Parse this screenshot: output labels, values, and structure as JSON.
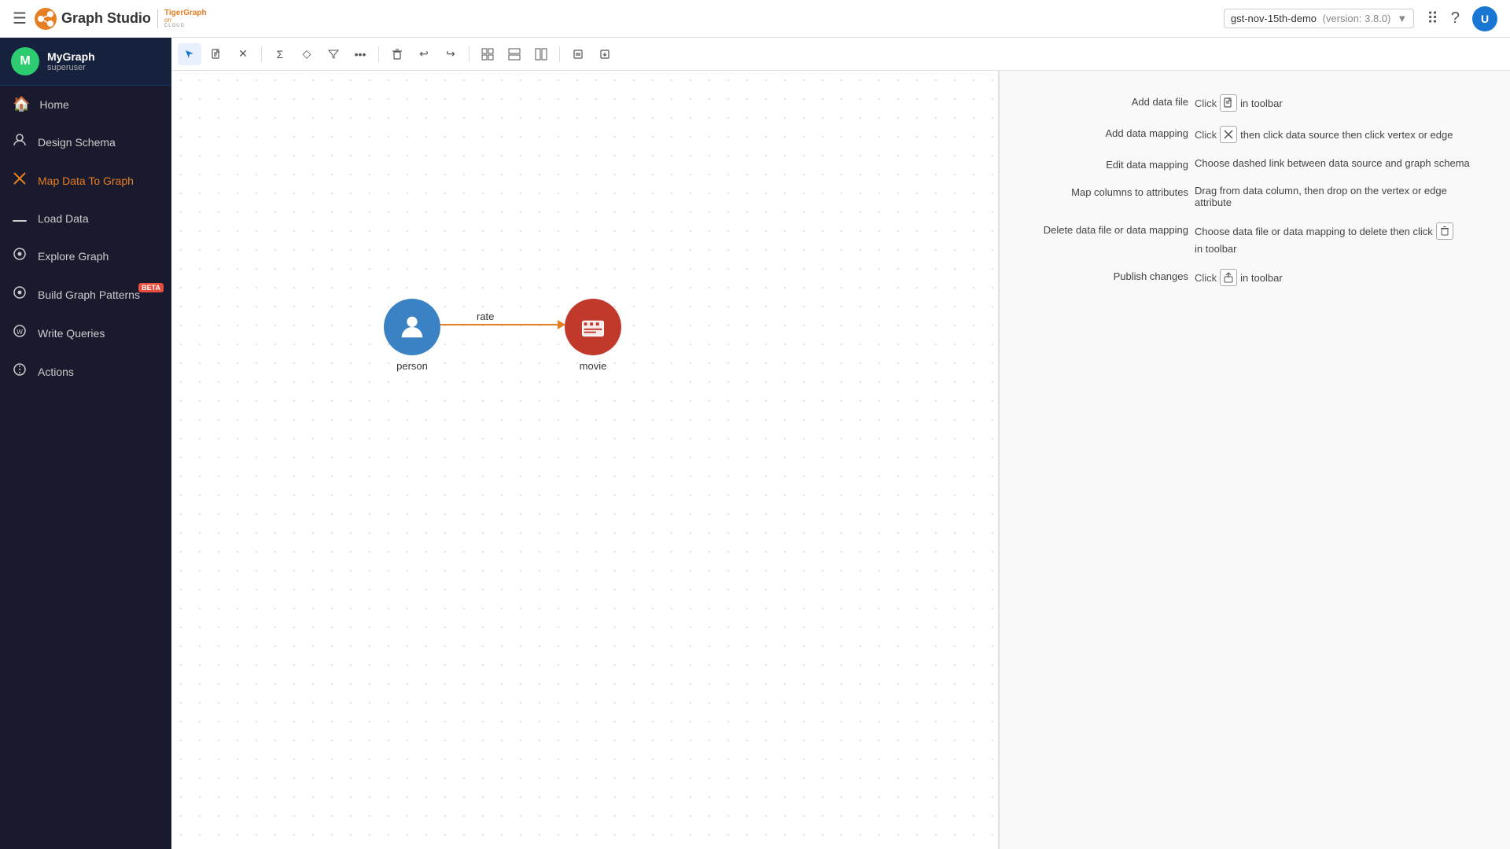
{
  "topbar": {
    "menu_icon": "☰",
    "app_title": "Graph Studio",
    "graph_selector": {
      "label": "gst-nov-15th-demo",
      "version": "(version: 3.8.0)"
    },
    "avatar_initials": "U"
  },
  "sidebar": {
    "graph": {
      "name": "MyGraph",
      "user": "superuser",
      "avatar": "M"
    },
    "nav_items": [
      {
        "id": "home",
        "label": "Home",
        "icon": "🏠",
        "active": false
      },
      {
        "id": "design-schema",
        "label": "Design Schema",
        "icon": "👤",
        "active": false
      },
      {
        "id": "map-data",
        "label": "Map Data To Graph",
        "icon": "✕",
        "active": true
      },
      {
        "id": "load-data",
        "label": "Load Data",
        "icon": "━",
        "active": false
      },
      {
        "id": "explore-graph",
        "label": "Explore Graph",
        "icon": "⊙",
        "active": false
      },
      {
        "id": "build-patterns",
        "label": "Build Graph Patterns",
        "icon": "⊙",
        "active": false,
        "beta": true
      },
      {
        "id": "write-queries",
        "label": "Write Queries",
        "icon": "🌐",
        "active": false
      },
      {
        "id": "actions",
        "label": "Actions",
        "icon": "⚙",
        "active": false
      }
    ]
  },
  "toolbar": {
    "buttons": [
      {
        "id": "select",
        "icon": "↗",
        "title": "Select"
      },
      {
        "id": "data-file",
        "icon": "📄",
        "title": "Add data file"
      },
      {
        "id": "close",
        "icon": "✕",
        "title": "Close"
      },
      {
        "id": "separator1"
      },
      {
        "id": "sum",
        "icon": "Σ",
        "title": "Summarize"
      },
      {
        "id": "expand",
        "icon": "◇",
        "title": "Expand"
      },
      {
        "id": "filter",
        "icon": "⚡",
        "title": "Filter"
      },
      {
        "id": "more",
        "icon": "•••",
        "title": "More"
      },
      {
        "id": "separator2"
      },
      {
        "id": "delete",
        "icon": "🗑",
        "title": "Delete"
      },
      {
        "id": "undo",
        "icon": "↩",
        "title": "Undo"
      },
      {
        "id": "redo",
        "icon": "↪",
        "title": "Redo"
      },
      {
        "id": "separator3"
      },
      {
        "id": "layout1",
        "icon": "▣",
        "title": "Layout 1"
      },
      {
        "id": "layout2",
        "icon": "▤",
        "title": "Layout 2"
      },
      {
        "id": "layout3",
        "icon": "▦",
        "title": "Layout 3"
      },
      {
        "id": "separator4"
      },
      {
        "id": "publish",
        "icon": "📋",
        "title": "Publish"
      },
      {
        "id": "export",
        "icon": "📋",
        "title": "Export"
      }
    ]
  },
  "graph": {
    "nodes": [
      {
        "id": "person",
        "label": "person",
        "type": "blue"
      },
      {
        "id": "movie",
        "label": "movie",
        "type": "red"
      }
    ],
    "edges": [
      {
        "id": "rate",
        "label": "rate",
        "from": "person",
        "to": "movie"
      }
    ]
  },
  "help_panel": {
    "rows": [
      {
        "id": "add-data-file",
        "label": "Add data file",
        "prefix": "Click",
        "icon": "📄",
        "suffix": "in toolbar"
      },
      {
        "id": "add-data-mapping",
        "label": "Add data mapping",
        "prefix": "Click",
        "icon": "✕",
        "suffix": "then click data source then click vertex or edge"
      },
      {
        "id": "edit-data-mapping",
        "label": "Edit data mapping",
        "prefix": "Choose dashed link between data source and graph schema",
        "icon": "",
        "suffix": ""
      },
      {
        "id": "map-columns",
        "label": "Map columns to attributes",
        "prefix": "Drag from data column, then drop on the vertex or edge attribute",
        "icon": "",
        "suffix": ""
      },
      {
        "id": "delete-data",
        "label": "Delete data file or data mapping",
        "prefix": "Choose data file or data mapping to delete then click",
        "icon": "🗑",
        "suffix": "in toolbar"
      },
      {
        "id": "publish-changes",
        "label": "Publish changes",
        "prefix": "Click",
        "icon": "⬆",
        "suffix": "in toolbar"
      }
    ]
  }
}
